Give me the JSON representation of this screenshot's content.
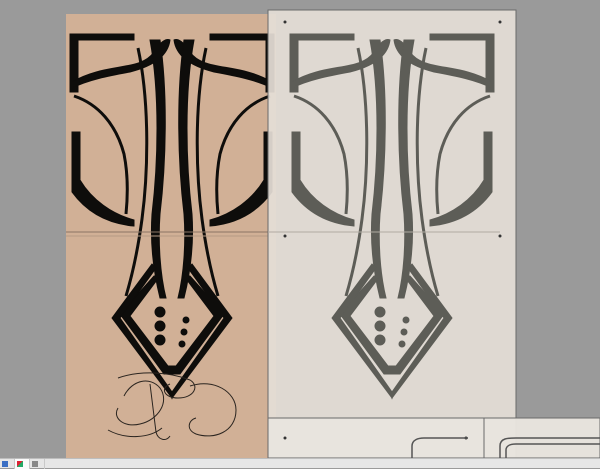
{
  "window": {
    "title": ""
  },
  "taskbar": {
    "items": [
      {
        "label": "",
        "icon": "app-icon"
      },
      {
        "label": "",
        "icon": "document-icon"
      },
      {
        "label": "",
        "icon": "window-icon"
      }
    ]
  },
  "colors": {
    "workspace_bg": "#9a9a9a",
    "reference_photo": "#d1b096",
    "stencil_ink_photo": "#0e0d0b",
    "stencil_ink_trace": "#5d5d57",
    "sheet_bg": "#e4ded6",
    "taskbar_bg": "#e6e6e6"
  }
}
